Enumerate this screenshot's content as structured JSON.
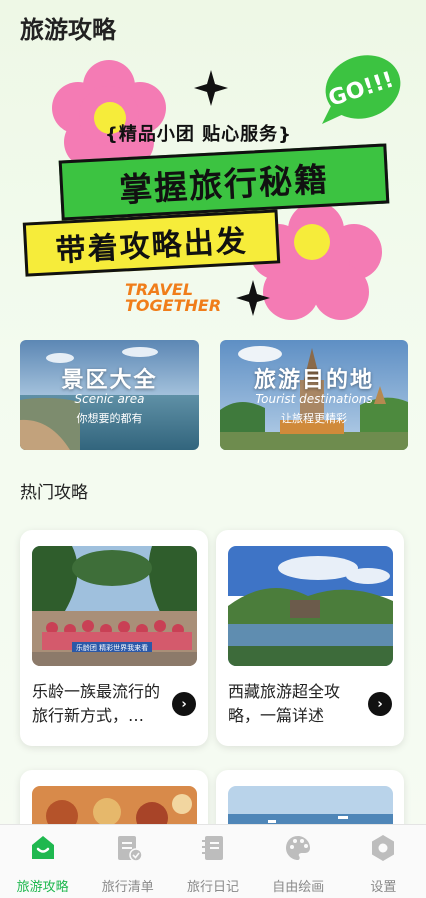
{
  "header": {
    "title": "旅游攻略"
  },
  "banner": {
    "go_text": "GO!!!",
    "tag": "{精品小团 贴心服务}",
    "slogan_main": "掌握旅行秘籍",
    "slogan_sub": "带着攻略出发",
    "travel_line1": "TRAVEL",
    "travel_line2": "TOGETHER"
  },
  "categories": [
    {
      "title": "景区大全",
      "subtitle_en": "Scenic area",
      "subtitle": "你想要的都有"
    },
    {
      "title": "旅游目的地",
      "subtitle_en": "Tourist destinations",
      "subtitle": "让旅程更精彩"
    }
  ],
  "section": {
    "title": "热门攻略"
  },
  "guides": [
    {
      "text": "乐龄一族最流行的旅行新方式，…",
      "image_banner": "乐龄团 精彩世界我来看"
    },
    {
      "text": "西藏旅游超全攻略，一篇详述"
    }
  ],
  "tabs": [
    {
      "label": "旅游攻略",
      "icon": "home-bag-icon",
      "active": true
    },
    {
      "label": "旅行清单",
      "icon": "checklist-icon",
      "active": false
    },
    {
      "label": "旅行日记",
      "icon": "diary-icon",
      "active": false
    },
    {
      "label": "自由绘画",
      "icon": "palette-icon",
      "active": false
    },
    {
      "label": "设置",
      "icon": "gear-icon",
      "active": false
    }
  ],
  "colors": {
    "accent": "#1fb84f",
    "banner_green": "#3cc341",
    "banner_yellow": "#f6ec3a",
    "flower_pink": "#f47bb4",
    "travel_orange": "#f07d1a"
  }
}
